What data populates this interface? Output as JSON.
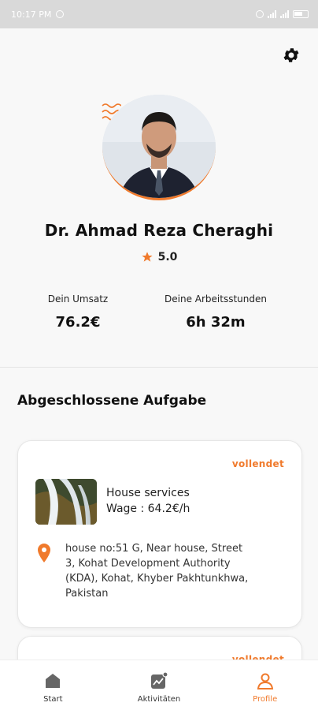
{
  "status_bar": {
    "time": "10:17 PM",
    "battery": "68"
  },
  "profile": {
    "name": "Dr. Ahmad  Reza Cheraghi",
    "rating": "5.0"
  },
  "stats": [
    {
      "label": "Dein Umsatz",
      "value": "76.2€"
    },
    {
      "label": "Deine Arbeitsstunden",
      "value": "6h 32m"
    }
  ],
  "section": {
    "title": "Abgeschlossene Aufgabe"
  },
  "tasks": [
    {
      "status": "vollendet",
      "title": "House services",
      "wage": "Wage : 64.2€/h",
      "address": "house no:51 G, Near house, Street 3, Kohat Development Authority (KDA), Kohat, Khyber Pakhtunkhwa, Pakistan"
    },
    {
      "status": "vollendet"
    }
  ],
  "nav": [
    {
      "label": "Start",
      "icon": "home-icon"
    },
    {
      "label": "Aktivitäten",
      "icon": "activity-icon"
    },
    {
      "label": "Profile",
      "icon": "profile-icon"
    }
  ],
  "colors": {
    "accent": "#f07a2c",
    "background": "#f8f8f8",
    "status_bar": "#d9d9d9"
  }
}
